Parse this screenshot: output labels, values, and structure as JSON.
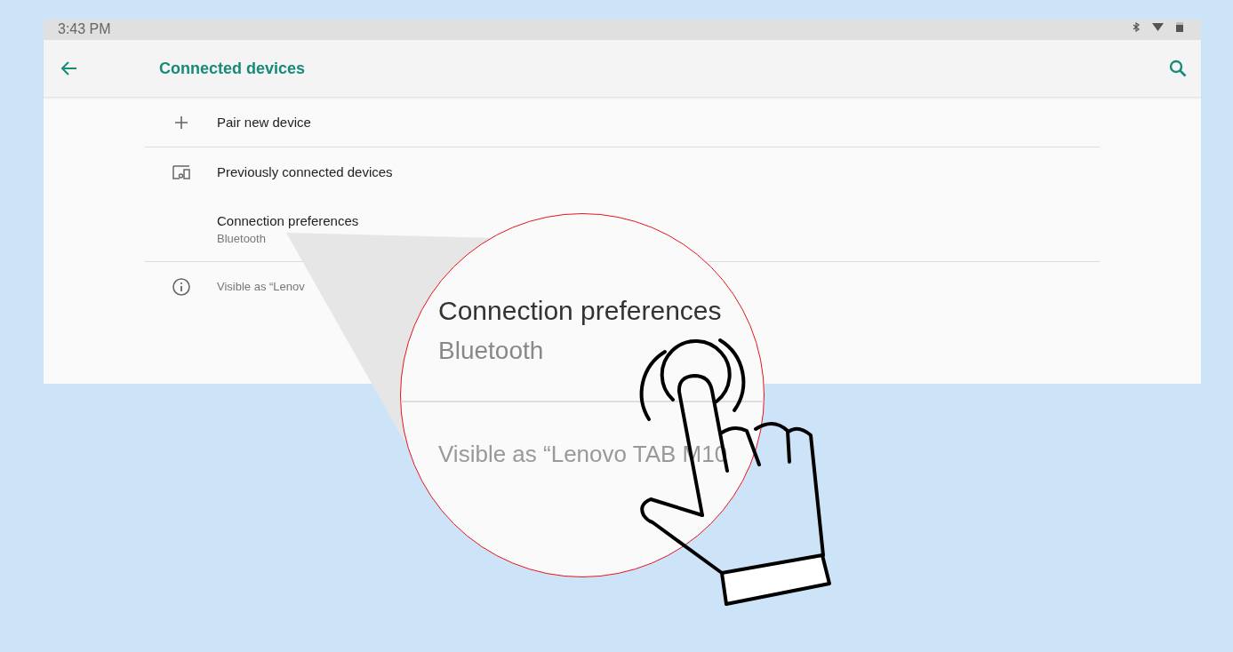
{
  "status_bar": {
    "time": "3:43 PM"
  },
  "app_bar": {
    "title": "Connected devices"
  },
  "items": [
    {
      "kind": "add",
      "title": "Pair new device",
      "divider": true
    },
    {
      "kind": "devices",
      "title": "Previously connected devices",
      "divider": false
    },
    {
      "kind": "plain",
      "title": "Connection preferences",
      "summary": "Bluetooth",
      "divider": true
    },
    {
      "kind": "info",
      "title": "Visible as “Lenov",
      "divider": false
    }
  ],
  "magnifier": {
    "title": "Connection preferences",
    "summary": "Bluetooth",
    "footer": "Visible as “Lenovo TAB M10"
  }
}
